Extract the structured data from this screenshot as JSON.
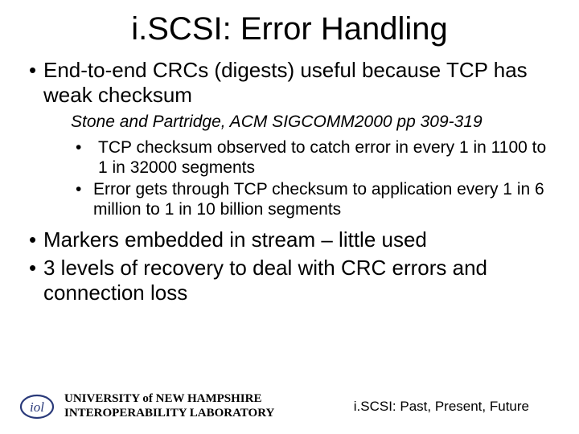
{
  "title": "i.SCSI: Error Handling",
  "bullets": {
    "b1": "End-to-end CRCs (digests) useful because TCP has weak checksum",
    "cite": "Stone and Partridge, ACM SIGCOMM2000 pp 309-319",
    "b1a": "TCP checksum observed to catch error in every 1 in 1100 to 1 in 32000 segments",
    "b1b": "Error gets through TCP checksum to application every 1 in 6 million to 1 in 10 billion segments",
    "b2": "Markers embedded in stream – little used",
    "b3": "3 levels of recovery to deal with CRC errors and connection loss"
  },
  "footer": {
    "org_line1": "UNIVERSITY of NEW HAMPSHIRE",
    "org_line2": "INTEROPERABILITY LABORATORY",
    "right": "i.SCSI: Past, Present, Future"
  }
}
